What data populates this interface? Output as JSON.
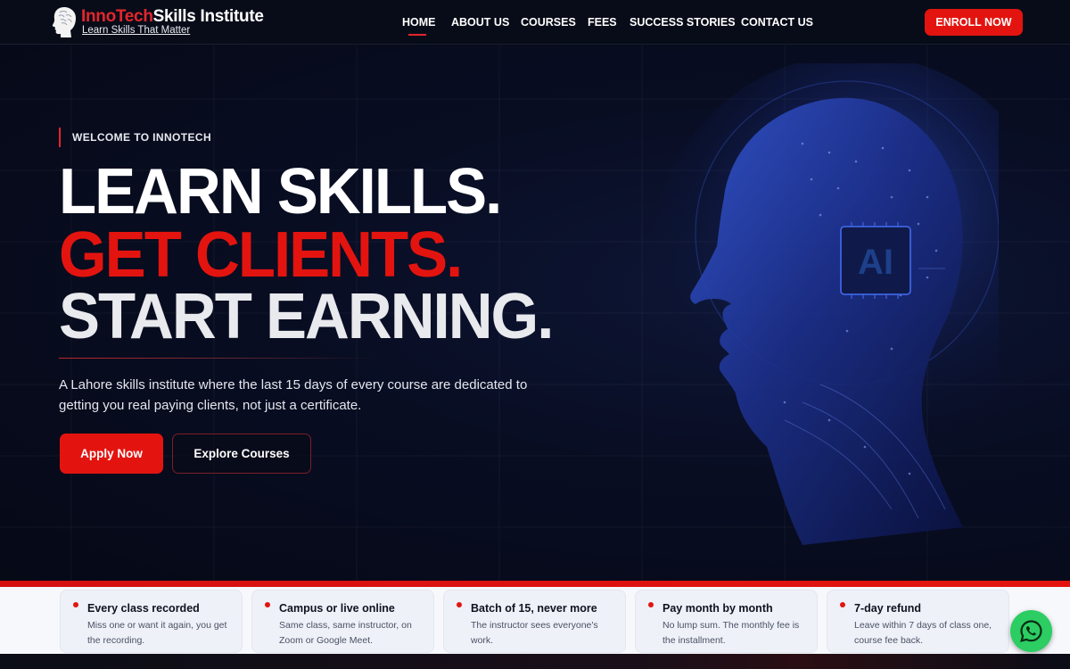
{
  "brand": {
    "name_part1": "InnoTech",
    "name_part2": "Skills Institute",
    "tagline": "Learn Skills That Matter",
    "accent_color": "#e3140f"
  },
  "nav": {
    "items": [
      {
        "label": "HOME",
        "active": true
      },
      {
        "label": "ABOUT US",
        "active": false
      },
      {
        "label": "COURSES",
        "active": false
      },
      {
        "label": "FEES",
        "active": false
      },
      {
        "label": "SUCCESS STORIES",
        "active": false
      },
      {
        "label": "CONTACT US",
        "active": false
      }
    ],
    "cta": "ENROLL NOW"
  },
  "hero": {
    "eyebrow": "WELCOME TO INNOTECH",
    "headline_1": "LEARN SKILLS.",
    "headline_2": "GET CLIENTS.",
    "headline_3": "START EARNING.",
    "description": "A Lahore skills institute where the last 15 days of every course are dedicated to getting you real paying clients, not just a certificate.",
    "primary_cta": "Apply Now",
    "secondary_cta": "Explore Courses",
    "chip_label": "AI"
  },
  "features": [
    {
      "title": "Every class recorded",
      "description": "Miss one or want it again, you get the recording."
    },
    {
      "title": "Campus or live online",
      "description": "Same class, same instructor, on Zoom or Google Meet."
    },
    {
      "title": "Batch of 15, never more",
      "description": "The instructor sees everyone's work."
    },
    {
      "title": "Pay month by month",
      "description": "No lump sum. The monthly fee is the installment."
    },
    {
      "title": "7-day refund",
      "description": "Leave within 7 days of class one, course fee back."
    }
  ],
  "whatsapp_icon": "whatsapp-icon"
}
